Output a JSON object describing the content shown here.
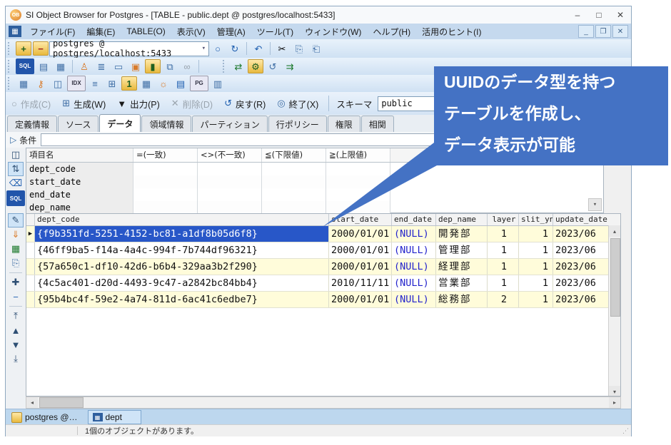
{
  "window": {
    "title": "SI Object Browser for Postgres - [TABLE - public.dept @ postgres/localhost:5433]",
    "minimize": "–",
    "maximize": "□",
    "close": "✕"
  },
  "menu": {
    "items": [
      "ファイル(F)",
      "編集(E)",
      "TABLE(O)",
      "表示(V)",
      "管理(A)",
      "ツール(T)",
      "ウィンドウ(W)",
      "ヘルプ(H)",
      "活用のヒント(I)"
    ],
    "mdi": {
      "min": "_",
      "restore": "❐",
      "close": "✕"
    }
  },
  "toolbar1": {
    "connection": "postgres @ postgres/localhost:5433",
    "combo_arrow": "▾"
  },
  "icons": {
    "app_logo": "OB",
    "menu_table": "▦",
    "db_add": "+",
    "db_remove": "−",
    "stop": "○",
    "refresh": "↻",
    "undo": "↶",
    "cut": "✂",
    "copy": "⎘",
    "paste": "⎗",
    "sql": "SQL",
    "script": "▤",
    "grid": "▦",
    "user": "♙",
    "db_stack": "≣",
    "computer": "▭",
    "lock": "▣",
    "cylinder": "▮",
    "pages": "⧉",
    "link": "∞",
    "sync": "⇄",
    "key2": "⚙",
    "recycle": "↺",
    "export": "⇉",
    "t_table": "▦",
    "t_key": "⚷",
    "t_view": "◫",
    "t_idx": "IDX",
    "t_tree": "≡",
    "t_win": "⊞",
    "t_num": "1",
    "t_cal": "▦",
    "t_lamp": "☼",
    "t_book": "▤",
    "t_pg": "PG",
    "t_form": "▥",
    "cond_play": "▷",
    "f_grid": "◫",
    "f_filter": "⇅",
    "f_erase": "⌫",
    "f_sql": "SQL",
    "d_edit": "✎",
    "d_import": "⇓",
    "d_excel": "▦",
    "d_copy": "⎘",
    "d_plus": "✚",
    "d_minus": "−",
    "d_first": "⤒",
    "d_prev": "▲",
    "d_next": "▼",
    "d_last": "⤓",
    "scroll_up": "▴",
    "scroll_down": "▾",
    "scroll_left": "◂",
    "scroll_right": "▸",
    "row_marker": "▶"
  },
  "actionbar": {
    "items": [
      {
        "glyph": "○",
        "label": "作成(C)"
      },
      {
        "glyph": "⊞",
        "label": "生成(W)"
      },
      {
        "glyph": "▼",
        "label": "出力(P)"
      },
      {
        "glyph": "✕",
        "label": "削除(D)"
      },
      {
        "glyph": "↺",
        "label": "戻す(R)"
      },
      {
        "glyph": "◎",
        "label": "終了(X)"
      }
    ],
    "schema_label": "スキーマ",
    "schema_value": "public"
  },
  "tabs": [
    "定義情報",
    "ソース",
    "データ",
    "領域情報",
    "パーティション",
    "行ポリシー",
    "権限",
    "相関"
  ],
  "condition": {
    "label": "条件",
    "value": ""
  },
  "filter_grid": {
    "columns": [
      "項目名",
      "=(一致)",
      "<>(不一致)",
      "≦(下限値)",
      "≧(上限値)"
    ],
    "rows": [
      "dept_code",
      "start_date",
      "end_date",
      "dep_name"
    ]
  },
  "data_grid": {
    "columns": [
      "dept_code",
      "start_date",
      "end_date",
      "dep_name",
      "layer",
      "slit_yn",
      "update_date"
    ],
    "rows": [
      {
        "c0": "{f9b351fd-5251-4152-bc81-a1df8b05d6f8}",
        "c1": "2000/01/01",
        "c2": "(NULL)",
        "c3": "開発部",
        "c4": "1",
        "c5": "1",
        "c6": "2023/06"
      },
      {
        "c0": "{46ff9ba5-f14a-4a4c-994f-7b744df96321}",
        "c1": "2000/01/01",
        "c2": "(NULL)",
        "c3": "管理部",
        "c4": "1",
        "c5": "1",
        "c6": "2023/06"
      },
      {
        "c0": "{57a650c1-df10-42d6-b6b4-329aa3b2f290}",
        "c1": "2000/01/01",
        "c2": "(NULL)",
        "c3": "経理部",
        "c4": "1",
        "c5": "1",
        "c6": "2023/06"
      },
      {
        "c0": "{4c5ac401-d20d-4493-9c47-a2842bc84bb4}",
        "c1": "2010/11/11",
        "c2": "(NULL)",
        "c3": "営業部",
        "c4": "1",
        "c5": "1",
        "c6": "2023/06"
      },
      {
        "c0": "{95b4bc4f-59e2-4a74-811d-6ac41c6edbe7}",
        "c1": "2000/01/01",
        "c2": "(NULL)",
        "c3": "総務部",
        "c4": "2",
        "c5": "1",
        "c6": "2023/06"
      }
    ]
  },
  "callout": {
    "line1": "UUIDのデータ型を持つ",
    "line2": "テーブルを作成し、",
    "line3": "データ表示が可能",
    "color": "#4472c4"
  },
  "taskbar": {
    "item1": "postgres @…",
    "item2": "dept"
  },
  "statusbar": {
    "message": "1個のオブジェクトがあります。"
  }
}
